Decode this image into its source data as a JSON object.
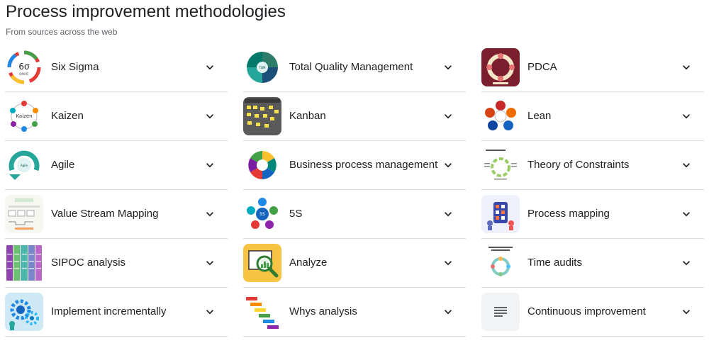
{
  "header": {
    "title": "Process improvement methodologies",
    "subtitle": "From sources across the web"
  },
  "columns": [
    {
      "items": [
        {
          "label": "Six Sigma",
          "icon": "six-sigma-dmaic-cycle"
        },
        {
          "label": "Kaizen",
          "icon": "kaizen-cycle"
        },
        {
          "label": "Agile",
          "icon": "agile-development-cycle"
        },
        {
          "label": "Value Stream Mapping",
          "icon": "value-stream-map"
        },
        {
          "label": "SIPOC analysis",
          "icon": "sipoc-table"
        },
        {
          "label": "Implement incrementally",
          "icon": "gears-illustration"
        }
      ]
    },
    {
      "items": [
        {
          "label": "Total Quality Management",
          "icon": "tqm-circle"
        },
        {
          "label": "Kanban",
          "icon": "kanban-board"
        },
        {
          "label": "Business process management",
          "icon": "bpm-lifecycle"
        },
        {
          "label": "5S",
          "icon": "five-s-circles"
        },
        {
          "label": "Analyze",
          "icon": "analyze-magnifier"
        },
        {
          "label": "Whys analysis",
          "icon": "whys-staircase"
        }
      ]
    },
    {
      "items": [
        {
          "label": "PDCA",
          "icon": "pdca-cycle"
        },
        {
          "label": "Lean",
          "icon": "lean-circles"
        },
        {
          "label": "Theory of Constraints",
          "icon": "theory-of-constraints-diagram"
        },
        {
          "label": "Process mapping",
          "icon": "process-mapping-illustration"
        },
        {
          "label": "Time audits",
          "icon": "time-audit-cycle"
        },
        {
          "label": "Continuous improvement",
          "icon": "text-lines-icon"
        }
      ]
    }
  ],
  "colors": {
    "divider": "#dadce0",
    "text": "#202124",
    "subtext": "#5f6368",
    "chevron": "#5f6368"
  }
}
